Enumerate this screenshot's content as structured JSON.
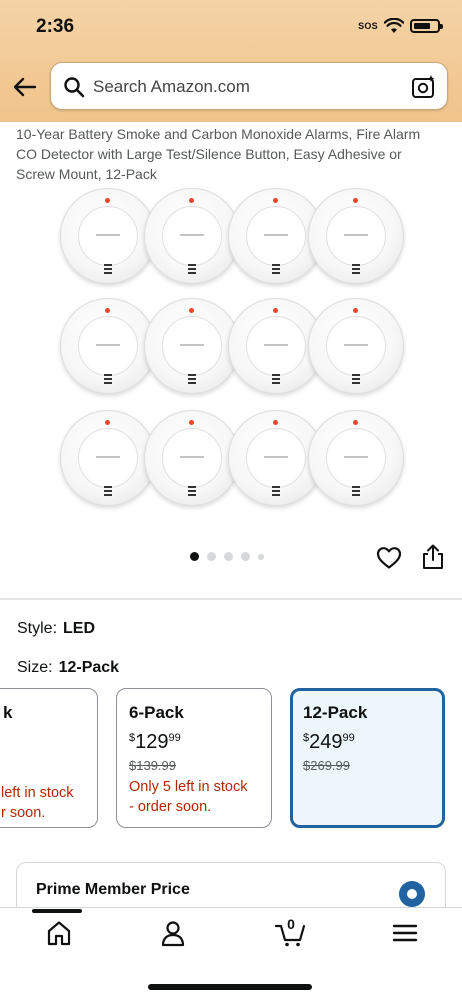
{
  "status_bar": {
    "time": "2:36",
    "sos": "SOS"
  },
  "search": {
    "placeholder": "Search Amazon.com"
  },
  "product": {
    "title": "10-Year Battery Smoke and Carbon Monoxide Alarms, Fire Alarm CO Detector with Large Test/Silence Button, Easy Adhesive or Screw Mount, 12-Pack",
    "image_count": 5,
    "active_image": 1
  },
  "options": {
    "style_label": "Style:",
    "style_value": "LED",
    "size_label": "Size:",
    "size_value": "12-Pack"
  },
  "size_cards": [
    {
      "name": "k",
      "stock_line1": "left in stock",
      "stock_line2": "r soon."
    },
    {
      "name": "6-Pack",
      "price_symbol": "$",
      "price_whole": "129",
      "price_cents": "99",
      "list_price": "$139.99",
      "stock_line1": "Only 5 left in stock",
      "stock_line2": "- order soon."
    },
    {
      "name": "12-Pack",
      "price_symbol": "$",
      "price_whole": "249",
      "price_cents": "99",
      "list_price": "$269.99",
      "selected": true
    }
  ],
  "prime": {
    "label": "Prime Member Price"
  },
  "nav": {
    "cart_count": "0"
  },
  "colors": {
    "header": "#f0c38a",
    "accent_blue": "#2162a1",
    "stock_red": "#b12704"
  }
}
